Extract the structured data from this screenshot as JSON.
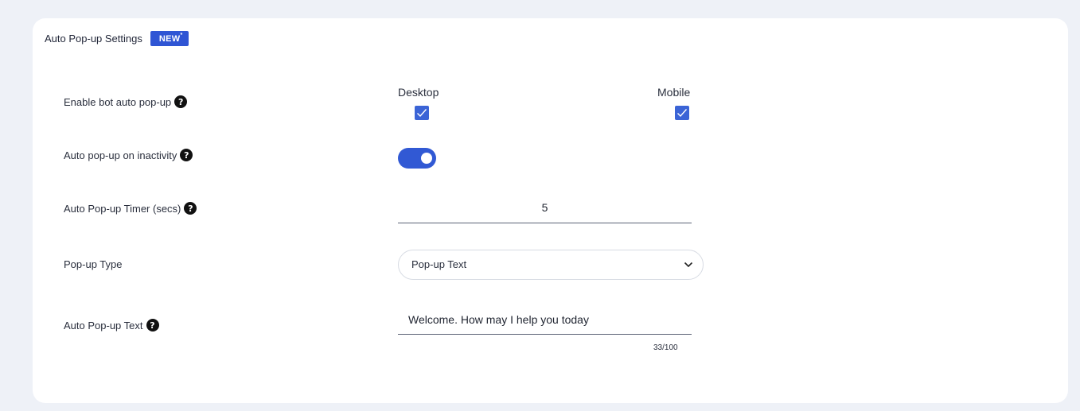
{
  "header": {
    "title": "Auto Pop-up Settings",
    "badge": "NEW",
    "badge_star": "*"
  },
  "rows": {
    "enable_popup": {
      "label": "Enable bot auto pop-up"
    },
    "inactivity": {
      "label": "Auto pop-up on inactivity",
      "enabled": true
    },
    "timer": {
      "label": "Auto Pop-up Timer (secs)",
      "value": "5"
    },
    "popup_type": {
      "label": "Pop-up Type",
      "selected": "Pop-up Text"
    },
    "popup_text": {
      "label": "Auto Pop-up Text",
      "value": "Welcome. How may I help you today",
      "counter": "33/100"
    }
  },
  "platforms": {
    "desktop": "Desktop",
    "mobile": "Mobile",
    "desktop_checked": true,
    "mobile_checked": true
  },
  "help_glyph": "?",
  "colors": {
    "accent": "#2f55d4",
    "background": "#eef1f7",
    "card": "#ffffff"
  }
}
